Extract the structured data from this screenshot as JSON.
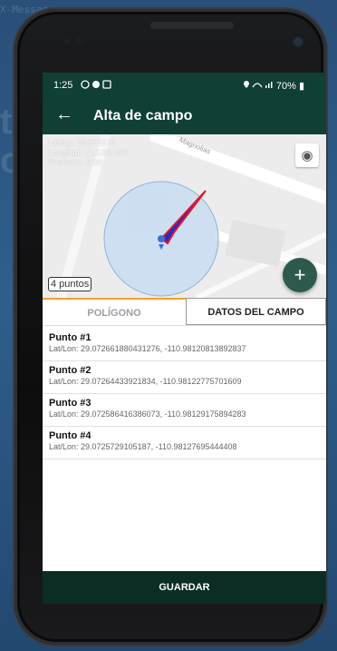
{
  "status": {
    "time": "1:25",
    "battery": "70%"
  },
  "appbar": {
    "title": "Alta de campo"
  },
  "map": {
    "latitude_line": "Latitud: 29.072579",
    "longitude_line": "Longitud: -110.981282",
    "precision_line": "Precisión: 6.00",
    "street_label": "Magnolias",
    "points_badge": "4 puntos",
    "fab_label": "+"
  },
  "tabs": {
    "polygon": "POLÍGONO",
    "field_data": "DATOS DEL CAMPO"
  },
  "points": [
    {
      "title": "Punto #1",
      "coords": "Lat/Lon: 29.072661880431276, -110.98120813892837"
    },
    {
      "title": "Punto #2",
      "coords": "Lat/Lon: 29.07264433921834, -110.98122775701609"
    },
    {
      "title": "Punto #3",
      "coords": "Lat/Lon: 29.072586416386073, -110.98129175894283"
    },
    {
      "title": "Punto #4",
      "coords": "Lat/Lon: 29.0725729105187, -110.98127695444408"
    }
  ],
  "footer": {
    "save_label": "GUARDAR"
  },
  "colors": {
    "appbar": "#0f3f35",
    "fab": "#2c5a4c",
    "tab_indicator": "#f0a030",
    "polygon_fill": "#2b2bc4",
    "polygon_stroke": "#e0162b"
  },
  "icons": {
    "back": "arrow-left-icon",
    "locate": "my-location-icon",
    "add": "plus-icon"
  }
}
